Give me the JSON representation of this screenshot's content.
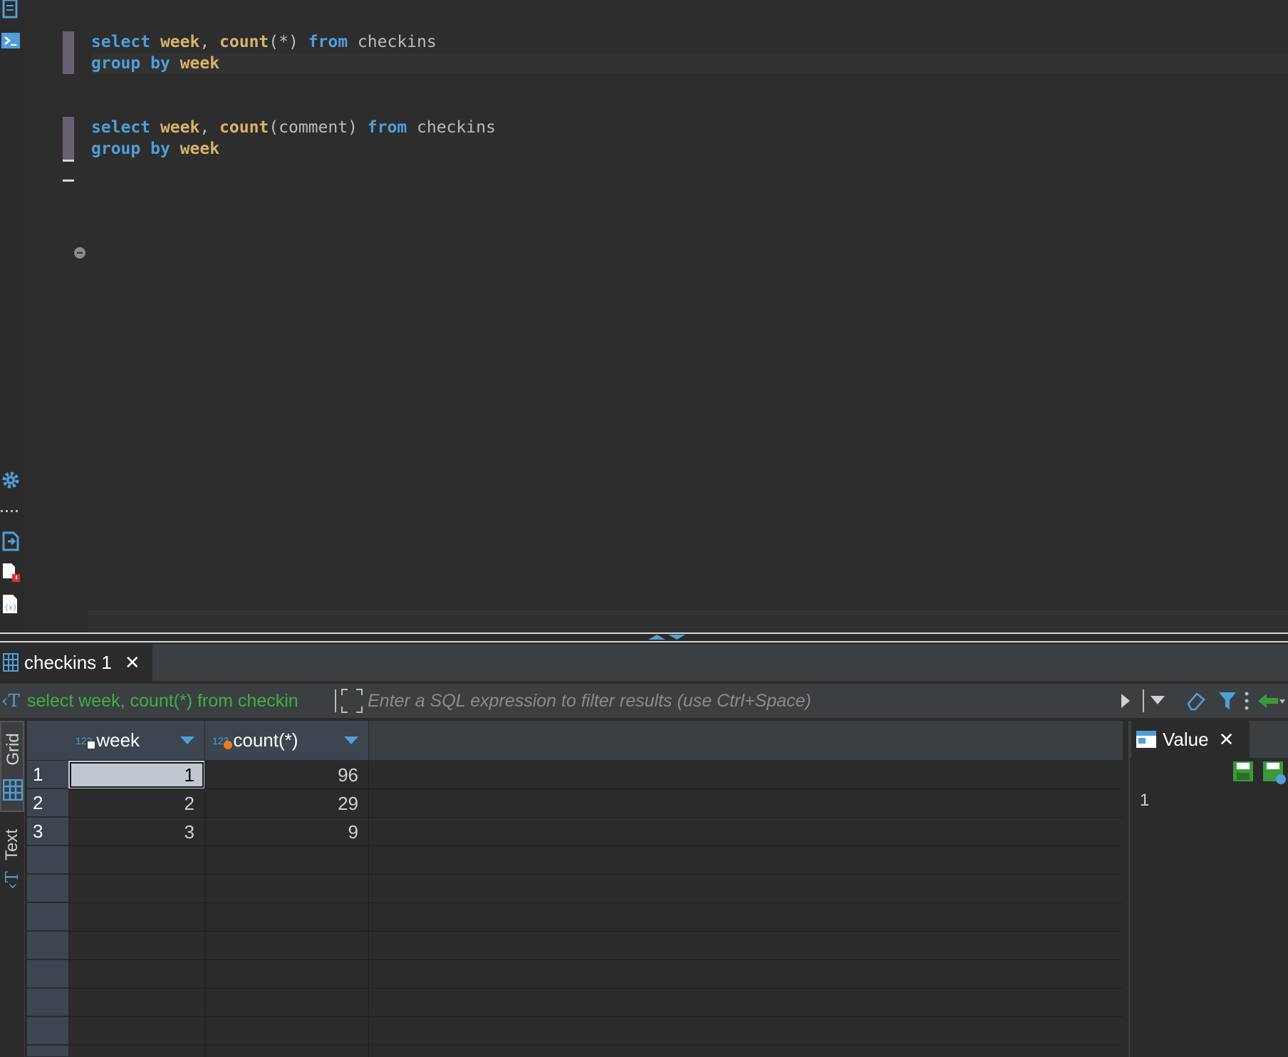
{
  "editor": {
    "statements": [
      {
        "line1": [
          {
            "t": "select",
            "c": "kw"
          },
          {
            "t": " ",
            "c": "plain"
          },
          {
            "t": "week",
            "c": "col"
          },
          {
            "t": ", ",
            "c": "plain"
          },
          {
            "t": "count",
            "c": "fn"
          },
          {
            "t": "(*) ",
            "c": "plain"
          },
          {
            "t": "from",
            "c": "kw"
          },
          {
            "t": " checkins",
            "c": "tbl"
          }
        ],
        "line2": [
          {
            "t": "group",
            "c": "kw"
          },
          {
            "t": " ",
            "c": "plain"
          },
          {
            "t": "by",
            "c": "kw"
          },
          {
            "t": " ",
            "c": "plain"
          },
          {
            "t": "week",
            "c": "col"
          }
        ]
      },
      {
        "line1": [
          {
            "t": "select",
            "c": "kw"
          },
          {
            "t": " ",
            "c": "plain"
          },
          {
            "t": "week",
            "c": "col"
          },
          {
            "t": ", ",
            "c": "plain"
          },
          {
            "t": "count",
            "c": "fn"
          },
          {
            "t": "(comment) ",
            "c": "plain"
          },
          {
            "t": "from",
            "c": "kw"
          },
          {
            "t": " checkins",
            "c": "tbl"
          }
        ],
        "line2": [
          {
            "t": "group",
            "c": "kw"
          },
          {
            "t": " ",
            "c": "plain"
          },
          {
            "t": "by",
            "c": "kw"
          },
          {
            "t": " ",
            "c": "plain"
          },
          {
            "t": "week",
            "c": "col"
          }
        ]
      }
    ]
  },
  "results": {
    "tab_label": "checkins 1",
    "filter_query": "select week, count(*) from checkin",
    "filter_placeholder": "Enter a SQL expression to filter results (use Ctrl+Space)",
    "side_tabs": [
      "Grid",
      "Text"
    ],
    "columns": [
      {
        "label": "week",
        "type": "123"
      },
      {
        "label": "count(*)",
        "type": "123"
      }
    ],
    "rows": [
      {
        "num": "1",
        "cells": [
          "1",
          "96"
        ]
      },
      {
        "num": "2",
        "cells": [
          "2",
          "29"
        ]
      },
      {
        "num": "3",
        "cells": [
          "3",
          "9"
        ]
      }
    ]
  },
  "value_panel": {
    "tab_label": "Value",
    "value": "1"
  },
  "colors": {
    "keyword": "#4f9fd8",
    "identifier": "#d8b36a",
    "query_green": "#3cb043",
    "accent_blue": "#4f9fd8"
  }
}
